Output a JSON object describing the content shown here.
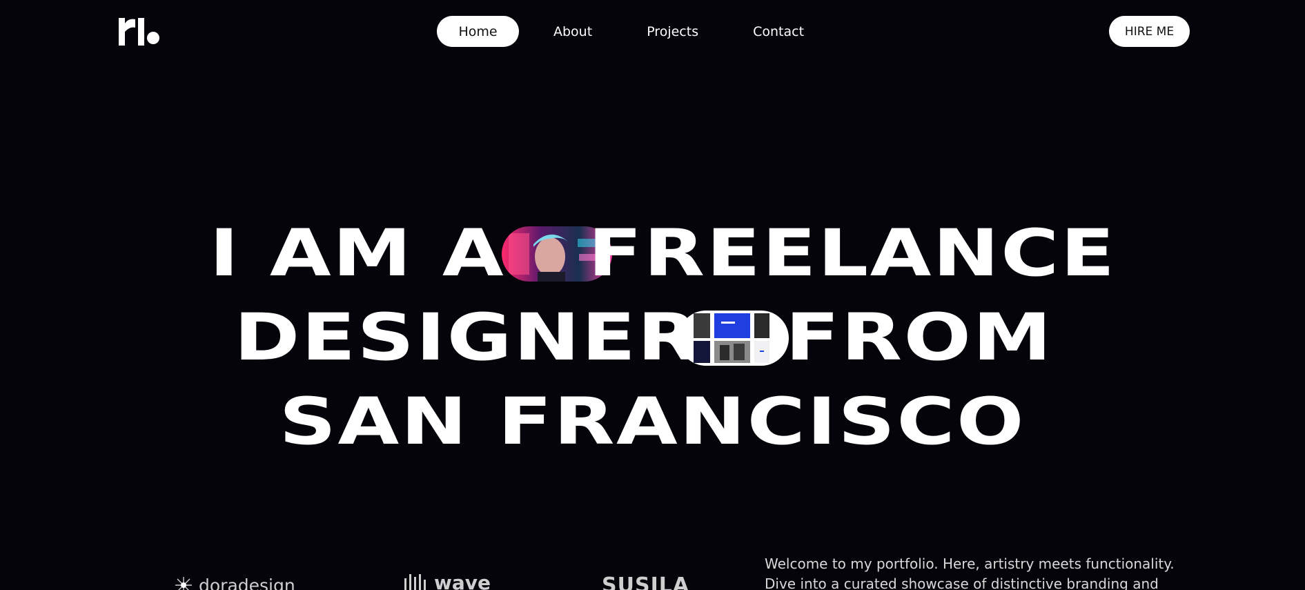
{
  "header": {
    "logo_alt": "rl. logo",
    "nav": [
      {
        "label": "Home",
        "active": true
      },
      {
        "label": "About",
        "active": false
      },
      {
        "label": "Projects",
        "active": false
      },
      {
        "label": "Contact",
        "active": false
      }
    ],
    "cta_label": "HIRE ME"
  },
  "hero": {
    "line1_a": "I AM A",
    "line1_b": "FREELANCE",
    "line2_a": "DESIGNER",
    "line2_b": "FROM",
    "line3": "SAN FRANCISCO"
  },
  "clients": [
    {
      "name": "doradesign",
      "icon": "starburst-icon"
    },
    {
      "name": "wave",
      "icon": "wave-bars-icon"
    },
    {
      "name": "SUSILA",
      "icon": ""
    }
  ],
  "intro": {
    "line1": "Welcome to my portfolio. Here, artistry meets functionality.",
    "line2": "Dive into a curated showcase of distinctive branding and"
  },
  "colors": {
    "background": "#04040a",
    "text": "#ffffff",
    "pill_button": "#ffffff"
  }
}
